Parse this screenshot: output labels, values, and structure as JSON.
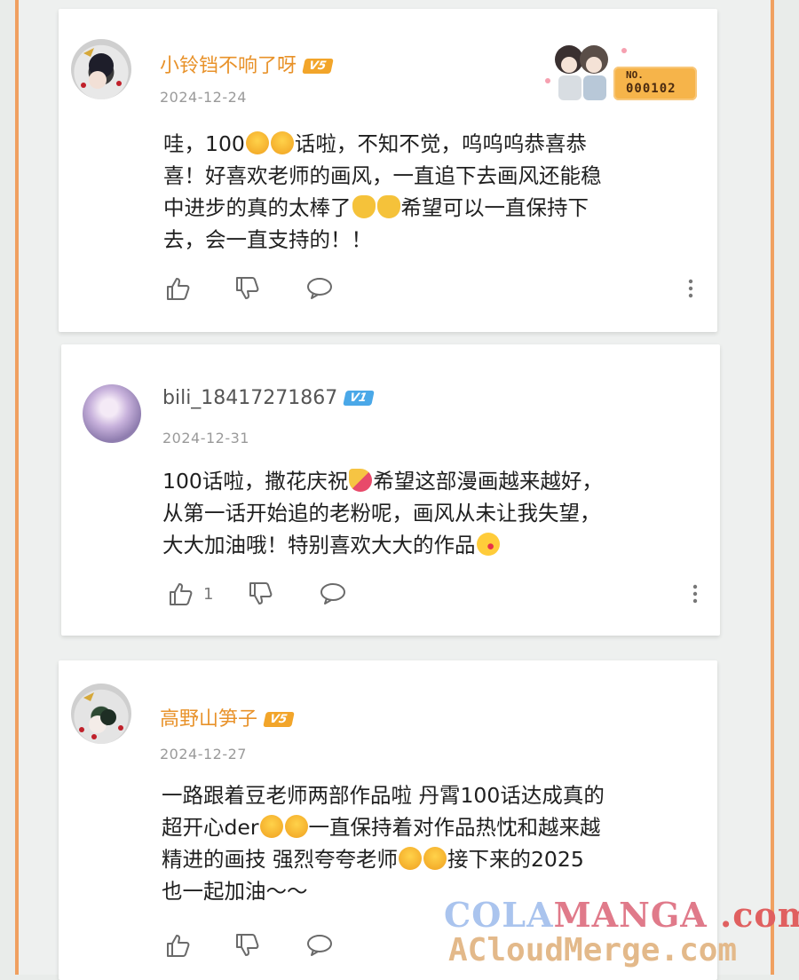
{
  "comments": [
    {
      "username": "小铃铛不响了呀",
      "level": "V5",
      "date": "2024-12-24",
      "text_parts": [
        "哇，100",
        "话啦，不知不觉，呜呜呜恭喜恭\n喜！好喜欢老师的画风，一直追下去画风还能稳\n中进步的真的太棒了",
        "希望可以一直保持下\n去，会一直支持的！！"
      ],
      "like_count": "",
      "badge": {
        "label": "NO.",
        "number": "000102"
      }
    },
    {
      "username": "bili_18417271867",
      "level": "V1",
      "date": "2024-12-31",
      "text_parts": [
        "100话啦，撒花庆祝",
        "希望这部漫画越来越好，\n从第一话开始追的老粉呢，画风从未让我失望，\n大大加油哦！特别喜欢大大的作品"
      ],
      "like_count": "1"
    },
    {
      "username": "高野山笋子",
      "level": "V5",
      "date": "2024-12-27",
      "text_parts": [
        "一路跟着豆老师两部作品啦 丹霄100话达成真的\n超开心der",
        "一直保持着对作品热忱和越来越\n精进的画技 强烈夸夸老师",
        "接下来的2025\n也一起加油～～"
      ],
      "like_count": ""
    }
  ],
  "watermark": {
    "line1_a": "COLA",
    "line1_b": "MANGA",
    "line1_c": ".com",
    "line2": "ACloudMerge.com"
  },
  "colors": {
    "v5_name": "#e8922a",
    "v1_name": "#555555",
    "v5_badge": "#f2a52a",
    "v1_badge": "#4aa8e8",
    "frame": "#f0a060"
  }
}
